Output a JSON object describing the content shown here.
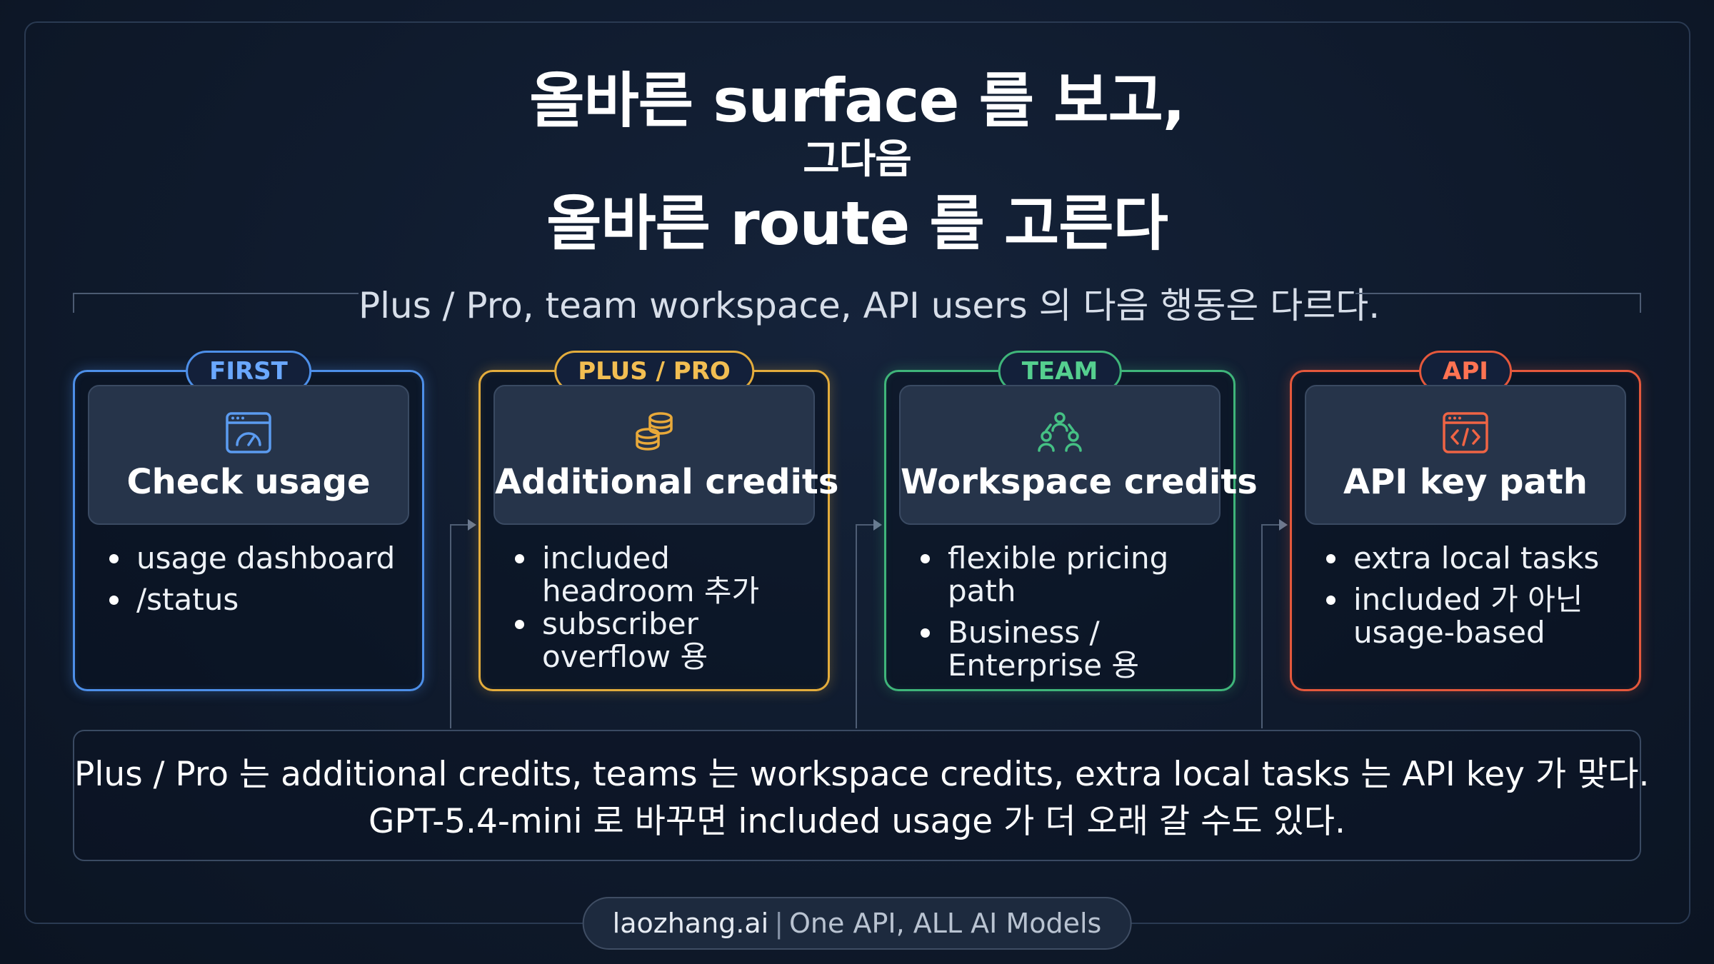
{
  "title": {
    "line1": "올바른 surface 를 보고,",
    "line2": "그다음",
    "line3": "올바른 route 를 고른다"
  },
  "subtitle": "Plus / Pro, team workspace, API users 의 다음 행동은 다르다.",
  "cards": [
    {
      "badge": "FIRST",
      "icon": "usage-gauge-icon",
      "title": "Check usage",
      "color": "#4d8fe8",
      "bullets": [
        "usage dashboard",
        "/status"
      ]
    },
    {
      "badge": "PLUS / PRO",
      "icon": "coins-icon",
      "title": "Additional credits",
      "color": "#e3ac3c",
      "bullets": [
        "included headroom 추가",
        "subscriber overflow 용"
      ]
    },
    {
      "badge": "TEAM",
      "icon": "team-icon",
      "title": "Workspace credits",
      "color": "#3fb57a",
      "bullets": [
        "flexible pricing path",
        "Business / Enterprise 용"
      ]
    },
    {
      "badge": "API",
      "icon": "code-window-icon",
      "title": "API key path",
      "color": "#e5583c",
      "bullets": [
        "extra local tasks",
        "included 가 아닌 usage-based"
      ]
    }
  ],
  "summary": {
    "line1": "Plus / Pro 는 additional credits, teams 는 workspace credits, extra local tasks 는 API key 가 맞다.",
    "line2": "GPT-5.4-mini 로 바꾸면 included usage 가 더 오래 갈 수도 있다."
  },
  "footer": {
    "brand": "laozhang.ai",
    "separator": "|",
    "tagline": "One API, ALL AI Models"
  }
}
